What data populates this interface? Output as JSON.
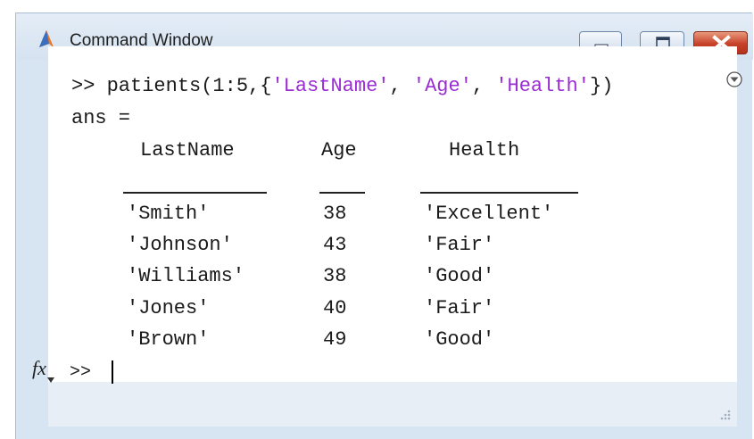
{
  "window": {
    "title": "Command Window",
    "icon": "matlab-icon"
  },
  "command": {
    "prompt": ">>",
    "code_prefix": "patients(1:5,{",
    "str1": "'LastName'",
    "sep1": ", ",
    "str2": "'Age'",
    "sep2": ", ",
    "str3": "'Health'",
    "code_suffix": "})"
  },
  "output": {
    "ans_label": "ans =",
    "headers": [
      "LastName",
      "Age",
      "Health"
    ],
    "rows": [
      {
        "last_name": "'Smith'",
        "age": "38",
        "health": "'Excellent'"
      },
      {
        "last_name": "'Johnson'",
        "age": "43",
        "health": "'Fair'"
      },
      {
        "last_name": "'Williams'",
        "age": "38",
        "health": "'Good'"
      },
      {
        "last_name": "'Jones'",
        "age": "40",
        "health": "'Fair'"
      },
      {
        "last_name": "'Brown'",
        "age": "49",
        "health": "'Good'"
      }
    ]
  },
  "input_line": {
    "fx_label": "fx",
    "prompt": ">>"
  },
  "colors": {
    "string": "#9b2bd3",
    "text": "#1a1a1a",
    "close_button": "#c6412a"
  }
}
